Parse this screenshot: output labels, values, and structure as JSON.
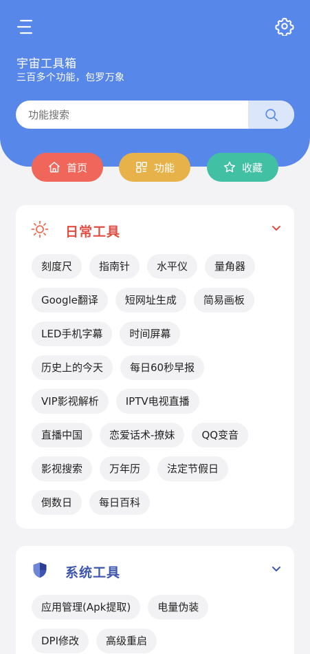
{
  "header": {
    "title": "宇宙工具箱",
    "subtitle": "三百多个功能，包罗万象",
    "menu_icon": "menu-icon",
    "settings_icon": "gear-icon",
    "bg_color": "#5887ea"
  },
  "search": {
    "placeholder": "功能搜索",
    "value": "",
    "button_icon": "search-icon"
  },
  "tabs": [
    {
      "label": "首页",
      "icon": "home-icon",
      "color": "#f0665a"
    },
    {
      "label": "功能",
      "icon": "grid-icon",
      "color": "#e8b24a"
    },
    {
      "label": "收藏",
      "icon": "star-icon",
      "color": "#42c0a4"
    }
  ],
  "sections": {
    "daily": {
      "title": "日常工具",
      "icon": "sun-icon",
      "title_color": "#e04d41",
      "rows": [
        [
          "刻度尺",
          "指南针",
          "水平仪",
          "量角器"
        ],
        [
          "Google翻译",
          "短网址生成",
          "简易画板"
        ],
        [
          "LED手机字幕",
          "时间屏幕"
        ],
        [
          "历史上的今天",
          "每日60秒早报"
        ],
        [
          "VIP影视解析",
          "IPTV电视直播"
        ],
        [
          "直播中国",
          "恋爱话术-撩妹",
          "QQ变音"
        ],
        [
          "影视搜索",
          "万年历",
          "法定节假日"
        ],
        [
          "倒数日",
          "每日百科"
        ]
      ]
    },
    "system": {
      "title": "系统工具",
      "icon": "shield-icon",
      "title_color": "#3d56b0",
      "rows": [
        [
          "应用管理(Apk提取)",
          "电量伪装"
        ],
        [
          "DPI修改",
          "高级重启"
        ]
      ]
    }
  }
}
